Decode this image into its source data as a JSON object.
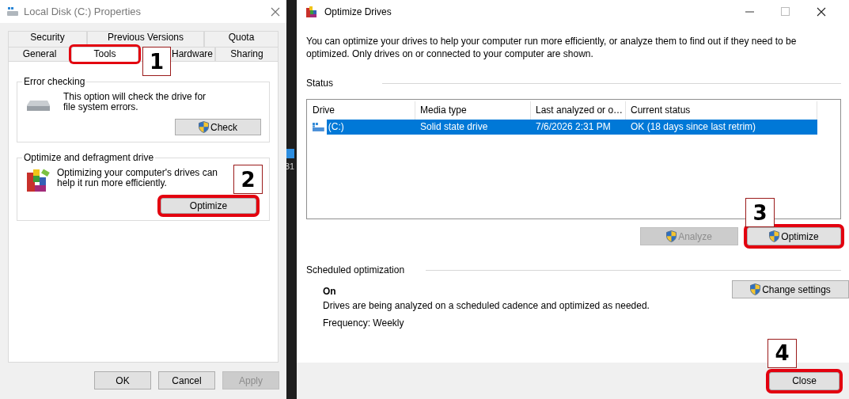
{
  "properties_dialog": {
    "title": "Local Disk (C:) Properties",
    "tabs_back_row": [
      {
        "label": "Security",
        "selected": false
      },
      {
        "label": "Previous Versions",
        "selected": false
      },
      {
        "label": "Quota",
        "selected": false
      }
    ],
    "tabs_front_row": [
      {
        "label": "General",
        "selected": false
      },
      {
        "label": "Tools",
        "selected": true,
        "callout": "1"
      },
      {
        "label": "Hardware",
        "selected": false
      },
      {
        "label": "Sharing",
        "selected": false
      }
    ],
    "error_checking": {
      "heading": "Error checking",
      "text": "This option will check the drive for file system errors.",
      "button": "Check"
    },
    "optimize_group": {
      "heading": "Optimize and defragment drive",
      "text": "Optimizing your computer's drives can help it run more efficiently.",
      "button": "Optimize",
      "callout": "2"
    },
    "buttons": [
      {
        "label": "OK",
        "disabled": false
      },
      {
        "label": "Cancel",
        "disabled": false
      },
      {
        "label": "Apply",
        "disabled": true
      }
    ]
  },
  "desktop_strip": {
    "text": "31"
  },
  "optimize_window": {
    "title": "Optimize Drives",
    "intro": "You can optimize your drives to help your computer run more efficiently, or analyze them to find out if they need to be optimized. Only drives on or connected to your computer are shown.",
    "status_heading": "Status",
    "columns": [
      "Drive",
      "Media type",
      "Last analyzed or o…",
      "Current status"
    ],
    "rows": [
      {
        "cells": [
          "(C:)",
          "Solid state drive",
          "7/6/2026 2:31 PM",
          "OK (18 days since last retrim)"
        ],
        "selected": true
      }
    ],
    "buttons": [
      {
        "label": "Analyze",
        "disabled": true
      },
      {
        "label": "Optimize",
        "disabled": false,
        "callout": "3"
      }
    ],
    "schedule_heading": "Scheduled optimization",
    "schedule_state": "On",
    "schedule_text": "Drives are being analyzed on a scheduled cadence and optimized as needed.",
    "frequency": "Frequency: Weekly",
    "change_button": "Change settings",
    "close_button": {
      "label": "Close",
      "callout": "4"
    }
  }
}
